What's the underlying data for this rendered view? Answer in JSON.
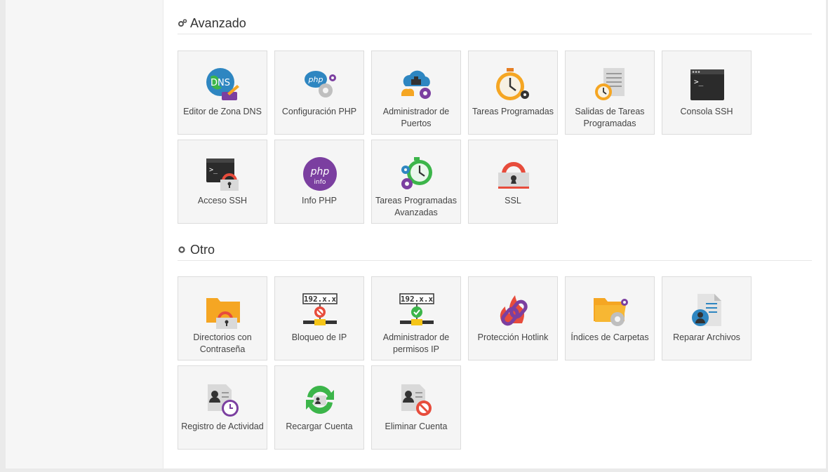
{
  "sections": [
    {
      "title": "Avanzado",
      "icon": "gears-icon",
      "tiles": [
        {
          "label": "Editor de Zona DNS",
          "icon": "dns-globe-icon"
        },
        {
          "label": "Configuración PHP",
          "icon": "php-config-icon"
        },
        {
          "label": "Administrador de Puertos",
          "icon": "port-cloud-icon"
        },
        {
          "label": "Tareas Programadas",
          "icon": "stopwatch-gear-icon"
        },
        {
          "label": "Salidas de Tareas Programadas",
          "icon": "task-output-icon"
        },
        {
          "label": "Consola SSH",
          "icon": "terminal-icon"
        },
        {
          "label": "Acceso SSH",
          "icon": "terminal-lock-icon"
        },
        {
          "label": "Info PHP",
          "icon": "php-info-icon"
        },
        {
          "label": "Tareas Programadas Avanzadas",
          "icon": "advanced-cron-icon"
        },
        {
          "label": "SSL",
          "icon": "ssl-lock-icon"
        }
      ]
    },
    {
      "title": "Otro",
      "icon": "gear-icon",
      "tiles": [
        {
          "label": "Directorios con Contraseña",
          "icon": "folder-lock-icon"
        },
        {
          "label": "Bloqueo de IP",
          "icon": "ip-block-icon",
          "ip_text": "192.x.x"
        },
        {
          "label": "Administrador de permisos IP",
          "icon": "ip-allow-icon",
          "ip_text": "192.x.x"
        },
        {
          "label": "Protección Hotlink",
          "icon": "hotlink-chain-icon"
        },
        {
          "label": "Índices de Carpetas",
          "icon": "folder-gear-icon"
        },
        {
          "label": "Reparar Archivos",
          "icon": "file-user-icon"
        },
        {
          "label": "Registro de Actividad",
          "icon": "activity-log-icon"
        },
        {
          "label": "Recargar Cuenta",
          "icon": "reload-account-icon"
        },
        {
          "label": "Eliminar Cuenta",
          "icon": "delete-account-icon"
        }
      ]
    }
  ],
  "colors": {
    "tile_bg": "#f5f5f5",
    "accent_orange": "#f5a623",
    "accent_purple": "#7b3fa0",
    "accent_red": "#e74c3c",
    "accent_green": "#3cb54a",
    "accent_blue": "#2e86c1"
  }
}
